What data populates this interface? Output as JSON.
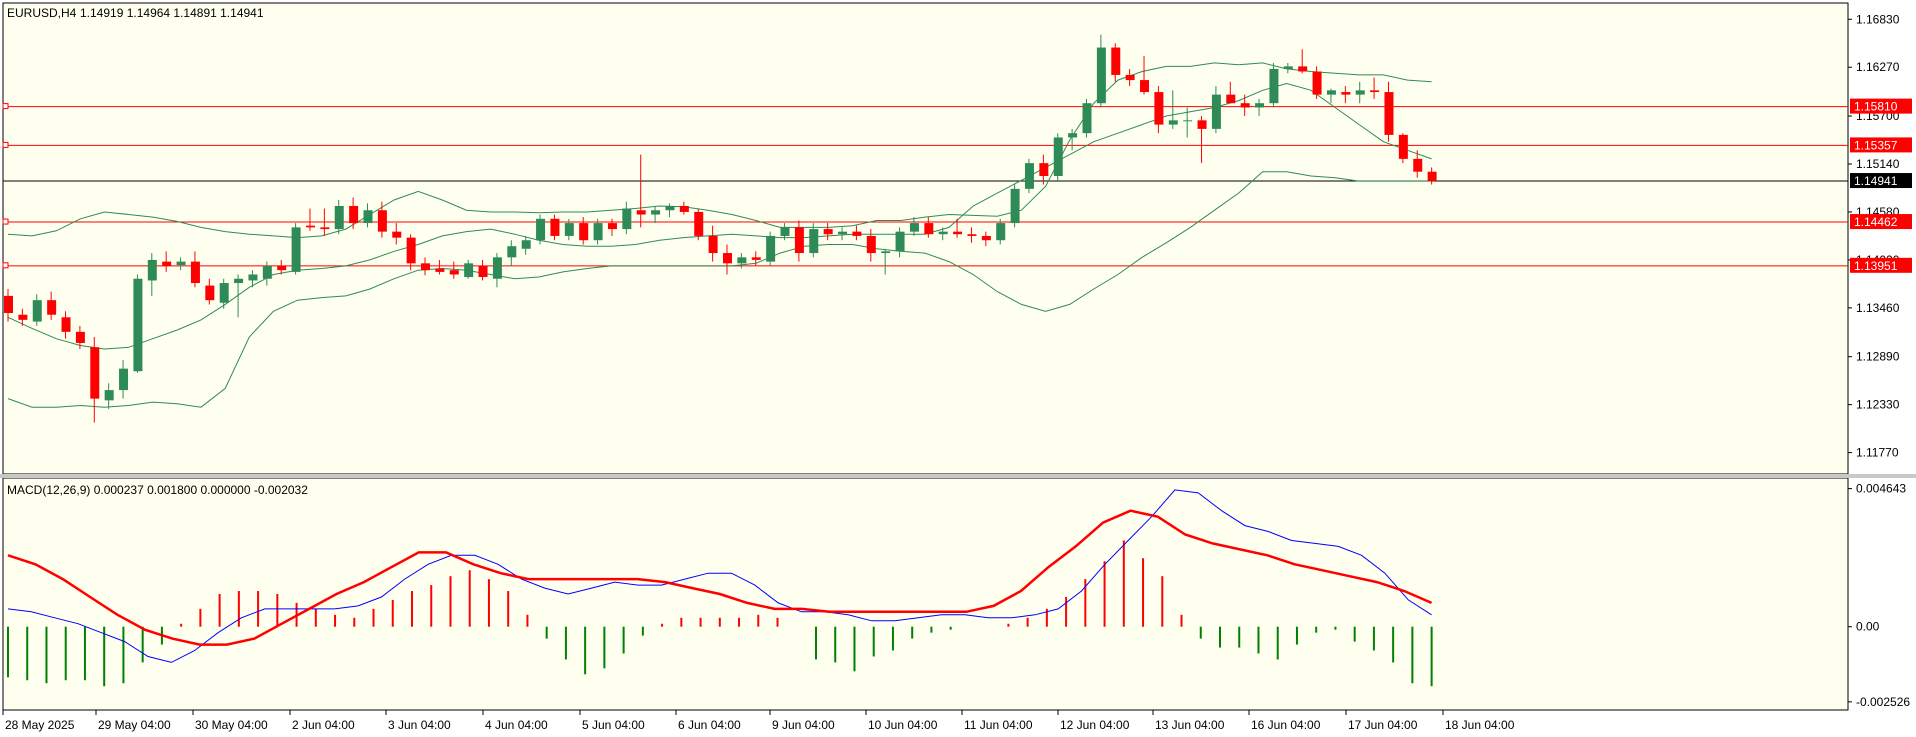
{
  "header": {
    "title": "EURUSD,H4",
    "ohlc": "1.14919 1.14964 1.14891 1.14941"
  },
  "indicator": {
    "label": "MACD(12,26,9) 0.000237 0.001800 0.000000 -0.002032"
  },
  "colors": {
    "background": "#fffff0",
    "bull": "#2e8b57",
    "bear": "#ff0000",
    "bands": "#2e8b57",
    "level": "#ff0000",
    "macd_main": "#0000ff",
    "macd_signal": "#ff0000",
    "hist_pos": "#ff0000",
    "hist_neg": "#008000"
  },
  "price_axis": {
    "ticks": [
      "1.16830",
      "1.16270",
      "1.15700",
      "1.15140",
      "1.14580",
      "1.14020",
      "1.13460",
      "1.12890",
      "1.12330",
      "1.11770"
    ],
    "ylim": [
      1.1152,
      1.1702
    ]
  },
  "macd_axis": {
    "ticks": [
      "0.004643",
      "0.00",
      "-0.002526"
    ],
    "ylim": [
      -0.0028,
      0.005
    ]
  },
  "levels": [
    {
      "label": "1.15810",
      "value": 1.1581
    },
    {
      "label": "1.15357",
      "value": 1.15357
    },
    {
      "label": "1.14462",
      "value": 1.14462
    },
    {
      "label": "1.13951",
      "value": 1.13951
    }
  ],
  "current_price": {
    "label": "1.14941",
    "value": 1.14941
  },
  "time_axis": {
    "labels": [
      "28 May 2025",
      "29 May 04:00",
      "30 May 04:00",
      "2 Jun 04:00",
      "3 Jun 04:00",
      "4 Jun 04:00",
      "5 Jun 04:00",
      "6 Jun 04:00",
      "9 Jun 04:00",
      "10 Jun 04:00",
      "11 Jun 04:00",
      "12 Jun 04:00",
      "13 Jun 04:00",
      "16 Jun 04:00",
      "17 Jun 04:00",
      "18 Jun 04:00"
    ]
  },
  "chart_data": {
    "type": "candlestick",
    "symbol": "EURUSD",
    "timeframe": "H4",
    "candles": [
      [
        1.136,
        1.1368,
        1.133,
        1.134
      ],
      [
        1.1338,
        1.1345,
        1.1325,
        1.1332
      ],
      [
        1.133,
        1.1362,
        1.1325,
        1.1355
      ],
      [
        1.1355,
        1.1365,
        1.1332,
        1.1338
      ],
      [
        1.1335,
        1.1342,
        1.131,
        1.1318
      ],
      [
        1.1318,
        1.1325,
        1.1298,
        1.1305
      ],
      [
        1.13,
        1.1312,
        1.1212,
        1.124
      ],
      [
        1.1238,
        1.1258,
        1.1228,
        1.125
      ],
      [
        1.125,
        1.1285,
        1.124,
        1.1275
      ],
      [
        1.1272,
        1.1385,
        1.127,
        1.138
      ],
      [
        1.1378,
        1.141,
        1.136,
        1.1402
      ],
      [
        1.14,
        1.1412,
        1.1388,
        1.1395
      ],
      [
        1.1396,
        1.1405,
        1.139,
        1.14
      ],
      [
        1.14,
        1.1412,
        1.137,
        1.1375
      ],
      [
        1.1372,
        1.138,
        1.135,
        1.1355
      ],
      [
        1.1352,
        1.138,
        1.1345,
        1.1375
      ],
      [
        1.1375,
        1.1385,
        1.1335,
        1.138
      ],
      [
        1.1378,
        1.139,
        1.137,
        1.1385
      ],
      [
        1.138,
        1.14,
        1.1372,
        1.1395
      ],
      [
        1.1395,
        1.1402,
        1.1385,
        1.139
      ],
      [
        1.1388,
        1.1445,
        1.1385,
        1.144
      ],
      [
        1.1442,
        1.1462,
        1.1436,
        1.144
      ],
      [
        1.144,
        1.1462,
        1.143,
        1.1438
      ],
      [
        1.1438,
        1.1472,
        1.1432,
        1.1465
      ],
      [
        1.1465,
        1.1475,
        1.1438,
        1.1445
      ],
      [
        1.1445,
        1.1468,
        1.144,
        1.146
      ],
      [
        1.146,
        1.147,
        1.1428,
        1.1435
      ],
      [
        1.1435,
        1.1445,
        1.142,
        1.1428
      ],
      [
        1.1428,
        1.1432,
        1.139,
        1.1398
      ],
      [
        1.1398,
        1.1405,
        1.1384,
        1.139
      ],
      [
        1.1392,
        1.1402,
        1.1385,
        1.1388
      ],
      [
        1.139,
        1.14,
        1.138,
        1.1385
      ],
      [
        1.1382,
        1.1402,
        1.138,
        1.1398
      ],
      [
        1.1395,
        1.1402,
        1.1378,
        1.1382
      ],
      [
        1.138,
        1.141,
        1.137,
        1.1405
      ],
      [
        1.1405,
        1.1425,
        1.1395,
        1.1418
      ],
      [
        1.1415,
        1.143,
        1.1408,
        1.1425
      ],
      [
        1.1425,
        1.1455,
        1.142,
        1.145
      ],
      [
        1.145,
        1.1455,
        1.1425,
        1.143
      ],
      [
        1.143,
        1.145,
        1.1425,
        1.1445
      ],
      [
        1.1445,
        1.1452,
        1.142,
        1.1425
      ],
      [
        1.1425,
        1.145,
        1.142,
        1.1445
      ],
      [
        1.1445,
        1.145,
        1.143,
        1.1438
      ],
      [
        1.1438,
        1.147,
        1.1432,
        1.1462
      ],
      [
        1.146,
        1.1525,
        1.144,
        1.1455
      ],
      [
        1.1455,
        1.1465,
        1.1445,
        1.146
      ],
      [
        1.146,
        1.1468,
        1.1452,
        1.1465
      ],
      [
        1.1465,
        1.147,
        1.1455,
        1.1458
      ],
      [
        1.1458,
        1.1462,
        1.1425,
        1.143
      ],
      [
        1.143,
        1.1442,
        1.14,
        1.141
      ],
      [
        1.141,
        1.142,
        1.1385,
        1.1398
      ],
      [
        1.1398,
        1.141,
        1.1392,
        1.1405
      ],
      [
        1.1405,
        1.1412,
        1.1395,
        1.1402
      ],
      [
        1.14,
        1.1435,
        1.1395,
        1.143
      ],
      [
        1.143,
        1.1445,
        1.1425,
        1.144
      ],
      [
        1.144,
        1.1448,
        1.14,
        1.141
      ],
      [
        1.141,
        1.1445,
        1.1405,
        1.1438
      ],
      [
        1.1438,
        1.1445,
        1.1425,
        1.1432
      ],
      [
        1.1432,
        1.144,
        1.1425,
        1.1435
      ],
      [
        1.1435,
        1.1442,
        1.1425,
        1.143
      ],
      [
        1.143,
        1.1438,
        1.14,
        1.141
      ],
      [
        1.141,
        1.1415,
        1.1385,
        1.1412
      ],
      [
        1.1412,
        1.144,
        1.1405,
        1.1435
      ],
      [
        1.1435,
        1.1452,
        1.143,
        1.1445
      ],
      [
        1.1445,
        1.1452,
        1.1428,
        1.1432
      ],
      [
        1.1432,
        1.144,
        1.1425,
        1.1435
      ],
      [
        1.1435,
        1.145,
        1.1428,
        1.1432
      ],
      [
        1.1432,
        1.144,
        1.1422,
        1.143
      ],
      [
        1.143,
        1.1435,
        1.1418,
        1.1425
      ],
      [
        1.1425,
        1.145,
        1.142,
        1.1445
      ],
      [
        1.1445,
        1.149,
        1.144,
        1.1485
      ],
      [
        1.1485,
        1.152,
        1.148,
        1.1515
      ],
      [
        1.1515,
        1.1525,
        1.149,
        1.15
      ],
      [
        1.15,
        1.155,
        1.1495,
        1.1545
      ],
      [
        1.1545,
        1.1555,
        1.153,
        1.155
      ],
      [
        1.155,
        1.159,
        1.1545,
        1.1585
      ],
      [
        1.1585,
        1.1665,
        1.158,
        1.165
      ],
      [
        1.165,
        1.1655,
        1.161,
        1.1618
      ],
      [
        1.1618,
        1.1625,
        1.1605,
        1.1612
      ],
      [
        1.1612,
        1.164,
        1.1595,
        1.1598
      ],
      [
        1.1598,
        1.1605,
        1.155,
        1.156
      ],
      [
        1.156,
        1.16,
        1.1555,
        1.1565
      ],
      [
        1.1565,
        1.158,
        1.1545,
        1.1565
      ],
      [
        1.1565,
        1.157,
        1.1515,
        1.1555
      ],
      [
        1.1555,
        1.1605,
        1.155,
        1.1595
      ],
      [
        1.1595,
        1.161,
        1.1585,
        1.1585
      ],
      [
        1.1585,
        1.1595,
        1.157,
        1.158
      ],
      [
        1.158,
        1.159,
        1.157,
        1.1585
      ],
      [
        1.1585,
        1.1632,
        1.158,
        1.1625
      ],
      [
        1.1625,
        1.1632,
        1.162,
        1.1628
      ],
      [
        1.1628,
        1.1648,
        1.162,
        1.1622
      ],
      [
        1.1622,
        1.1628,
        1.159,
        1.1595
      ],
      [
        1.1595,
        1.1602,
        1.1585,
        1.16
      ],
      [
        1.1598,
        1.1605,
        1.1585,
        1.1595
      ],
      [
        1.1595,
        1.161,
        1.1585,
        1.16
      ],
      [
        1.16,
        1.1615,
        1.159,
        1.1598
      ],
      [
        1.1598,
        1.161,
        1.154,
        1.1548
      ],
      [
        1.1548,
        1.155,
        1.1515,
        1.152
      ],
      [
        1.152,
        1.153,
        1.1498,
        1.1505
      ],
      [
        1.1505,
        1.151,
        1.149,
        1.1494
      ]
    ],
    "bands": {
      "upper": [
        1.1432,
        1.143,
        1.1436,
        1.145,
        1.1458,
        1.1455,
        1.1452,
        1.1447,
        1.144,
        1.1435,
        1.1432,
        1.143,
        1.1428,
        1.143,
        1.1438,
        1.1455,
        1.1472,
        1.1482,
        1.1472,
        1.146,
        1.1458,
        1.1458,
        1.1457,
        1.1458,
        1.1458,
        1.146,
        1.1462,
        1.1465,
        1.1464,
        1.146,
        1.1455,
        1.1448,
        1.144,
        1.144,
        1.144,
        1.1442,
        1.1448,
        1.1448,
        1.1452,
        1.1455,
        1.1454,
        1.1453,
        1.146,
        1.1488,
        1.1542,
        1.1585,
        1.1612,
        1.1622,
        1.1628,
        1.1628,
        1.1632,
        1.163,
        1.1632,
        1.1625,
        1.1622,
        1.162,
        1.1618,
        1.1618,
        1.1612,
        1.161
      ],
      "middle": [
        1.1335,
        1.1322,
        1.131,
        1.1302,
        1.1298,
        1.13,
        1.131,
        1.132,
        1.1332,
        1.135,
        1.137,
        1.1385,
        1.139,
        1.1392,
        1.1395,
        1.1402,
        1.1412,
        1.142,
        1.143,
        1.1435,
        1.1438,
        1.1432,
        1.1425,
        1.142,
        1.1418,
        1.1418,
        1.142,
        1.1425,
        1.1428,
        1.143,
        1.1432,
        1.143,
        1.1428,
        1.1428,
        1.143,
        1.1432,
        1.1432,
        1.1432,
        1.1432,
        1.144,
        1.1465,
        1.148,
        1.1495,
        1.151,
        1.1525,
        1.154,
        1.155,
        1.156,
        1.157,
        1.1575,
        1.158,
        1.1588,
        1.16,
        1.1608,
        1.16,
        1.158,
        1.156,
        1.154,
        1.153,
        1.152
      ],
      "lower": [
        1.124,
        1.123,
        1.123,
        1.1232,
        1.123,
        1.1232,
        1.1236,
        1.1234,
        1.123,
        1.1252,
        1.1312,
        1.1342,
        1.1355,
        1.1358,
        1.136,
        1.1368,
        1.138,
        1.139,
        1.1392,
        1.139,
        1.1385,
        1.138,
        1.1382,
        1.1388,
        1.1392,
        1.1395,
        1.1395,
        1.1395,
        1.1395,
        1.1395,
        1.1395,
        1.1398,
        1.141,
        1.1418,
        1.142,
        1.142,
        1.1415,
        1.1412,
        1.141,
        1.14,
        1.1385,
        1.1365,
        1.135,
        1.1342,
        1.135,
        1.1368,
        1.1385,
        1.1405,
        1.1422,
        1.144,
        1.146,
        1.148,
        1.1505,
        1.1505,
        1.15,
        1.1498,
        1.1494,
        1.1494,
        1.1494,
        1.1494
      ]
    },
    "macd": {
      "main": [
        0.0006,
        0.0005,
        0.0003,
        0.0001,
        -0.0002,
        -0.0005,
        -0.001,
        -0.0012,
        -0.0008,
        -0.0002,
        0.0003,
        0.0006,
        0.0006,
        0.0006,
        0.0006,
        0.0007,
        0.001,
        0.0016,
        0.0021,
        0.0024,
        0.0024,
        0.0021,
        0.0016,
        0.0013,
        0.0011,
        0.0013,
        0.0015,
        0.0014,
        0.0014,
        0.0016,
        0.0018,
        0.0018,
        0.0014,
        0.0008,
        0.0005,
        0.0005,
        0.0004,
        0.0002,
        0.0002,
        0.0003,
        0.0004,
        0.0004,
        0.0003,
        0.0003,
        0.0004,
        0.0006,
        0.0012,
        0.0021,
        0.0029,
        0.0037,
        0.0046,
        0.0045,
        0.0039,
        0.0034,
        0.0032,
        0.0029,
        0.0028,
        0.0027,
        0.0024,
        0.0018,
        0.0009,
        0.0004
      ],
      "signal": [
        0.0024,
        0.0021,
        0.0016,
        0.001,
        0.0004,
        -0.0001,
        -0.0004,
        -0.0006,
        -0.0006,
        -0.0004,
        0.0001,
        0.0006,
        0.0011,
        0.0015,
        0.002,
        0.0025,
        0.0025,
        0.0021,
        0.0018,
        0.0016,
        0.0016,
        0.0016,
        0.0016,
        0.0016,
        0.0015,
        0.0013,
        0.0011,
        0.0008,
        0.0006,
        0.0006,
        0.0005,
        0.0005,
        0.0005,
        0.0005,
        0.0005,
        0.0005,
        0.0007,
        0.0012,
        0.002,
        0.0027,
        0.0035,
        0.0039,
        0.0037,
        0.0031,
        0.0028,
        0.0026,
        0.0024,
        0.0021,
        0.0019,
        0.0017,
        0.0015,
        0.0012,
        0.0008
      ],
      "histogram": [
        -0.0017,
        -0.0018,
        -0.0019,
        -0.0018,
        -0.0018,
        -0.002,
        -0.0019,
        -0.0012,
        -0.0006,
        0.0001,
        0.0006,
        0.0011,
        0.0012,
        0.0012,
        0.0011,
        0.0008,
        0.0006,
        0.0004,
        0.0003,
        0.0006,
        0.0009,
        0.0012,
        0.0014,
        0.0017,
        0.0019,
        0.0016,
        0.0012,
        0.0004,
        -0.0004,
        -0.0011,
        -0.0016,
        -0.0014,
        -0.0009,
        -0.0003,
        0.0001,
        0.0003,
        0.0003,
        0.0003,
        0.0003,
        0.0004,
        0.0003,
        0.0,
        -0.0011,
        -0.0012,
        -0.0015,
        -0.001,
        -0.0008,
        -0.0004,
        -0.0002,
        -0.0001,
        -0.0,
        0.0,
        0.0001,
        0.0003,
        0.0006,
        0.001,
        0.0016,
        0.0022,
        0.0029,
        0.0023,
        0.0017,
        0.0004,
        -0.0004,
        -0.0007,
        -0.0007,
        -0.0009,
        -0.0011,
        -0.0006,
        -0.0002,
        -0.0001,
        -0.0005,
        -0.0008,
        -0.0012,
        -0.0019,
        -0.002
      ]
    }
  }
}
